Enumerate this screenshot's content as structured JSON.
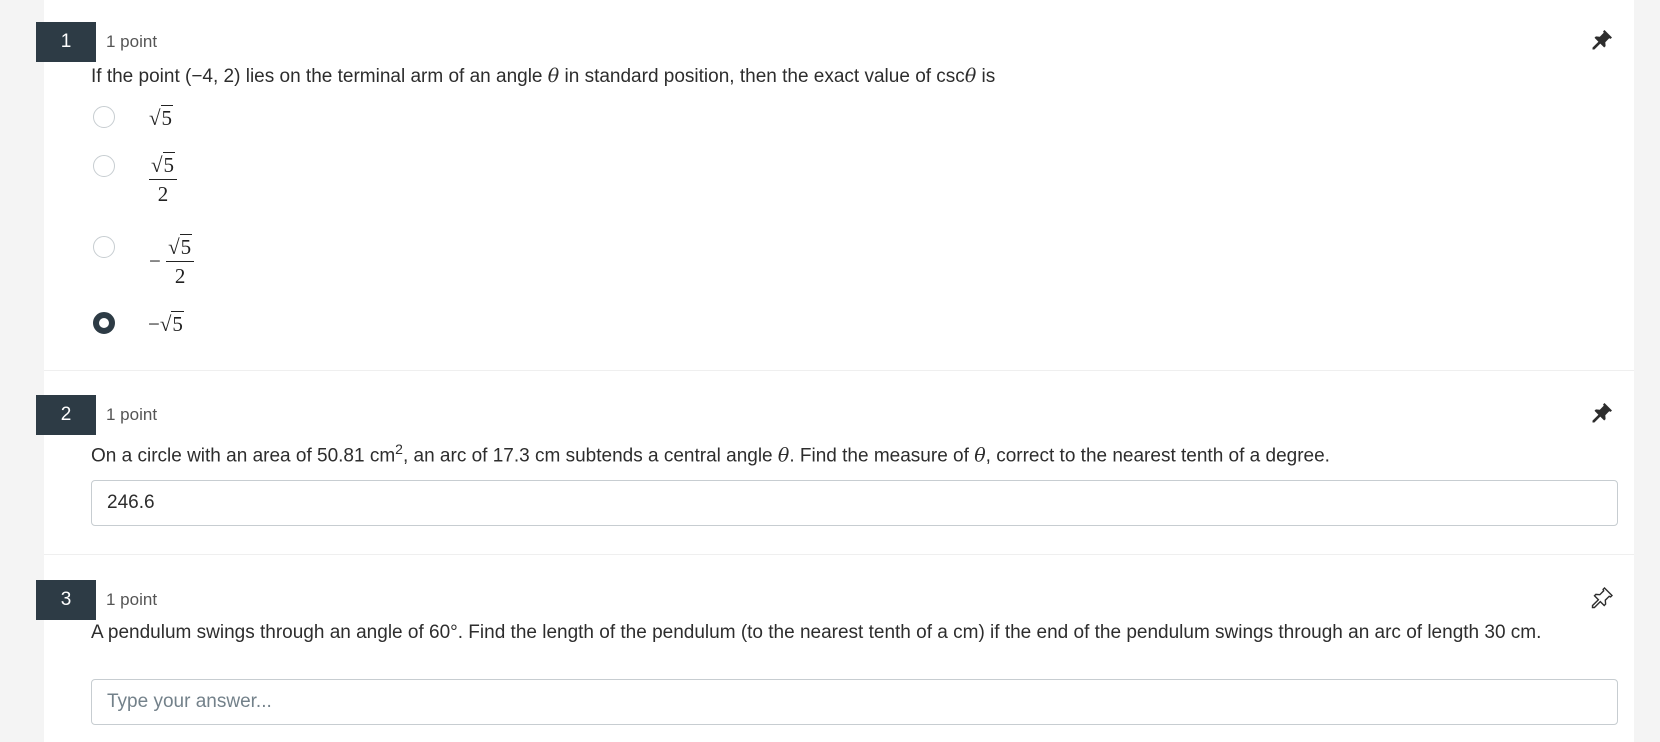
{
  "questions": [
    {
      "number": "1",
      "points": "1 point",
      "text_before": "If the point (−4, 2) lies on the terminal arm of an angle ",
      "theta": "θ",
      "text_middle": " in standard position, then the exact value of csc",
      "text_after": " is",
      "options": [
        {
          "sign": "",
          "radicand": "5",
          "denominator": "",
          "selected": false
        },
        {
          "sign": "",
          "radicand": "5",
          "denominator": "2",
          "selected": false
        },
        {
          "sign": "−",
          "radicand": "5",
          "denominator": "2",
          "selected": false
        },
        {
          "sign": "−",
          "radicand": "5",
          "denominator": "",
          "selected": true
        }
      ],
      "pin_icon": "pin-filled-icon"
    },
    {
      "number": "2",
      "points": "1 point",
      "text_a": "On a circle with an area of 50.81 cm",
      "sup": "2",
      "text_b": ", an arc of 17.3 cm subtends a central angle ",
      "theta": "θ",
      "text_c": ". Find the measure of ",
      "text_d": ", correct to the nearest tenth of a degree.",
      "answer_value": "246.6",
      "pin_icon": "pin-filled-icon"
    },
    {
      "number": "3",
      "points": "1 point",
      "text": "A pendulum swings through an angle of 60°. Find the length of the pendulum (to the nearest tenth of a cm) if the end of the pendulum swings through an arc of length 30 cm.",
      "answer_value": "",
      "answer_placeholder": "Type your answer...",
      "pin_icon": "pin-outline-icon"
    }
  ],
  "colors": {
    "badge_bg": "#2d3b45",
    "page_bg": "#f4f4f4",
    "panel_bg": "#ffffff",
    "input_border": "#c7cdd1",
    "placeholder": "#73818a"
  },
  "radical_symbol": "√"
}
